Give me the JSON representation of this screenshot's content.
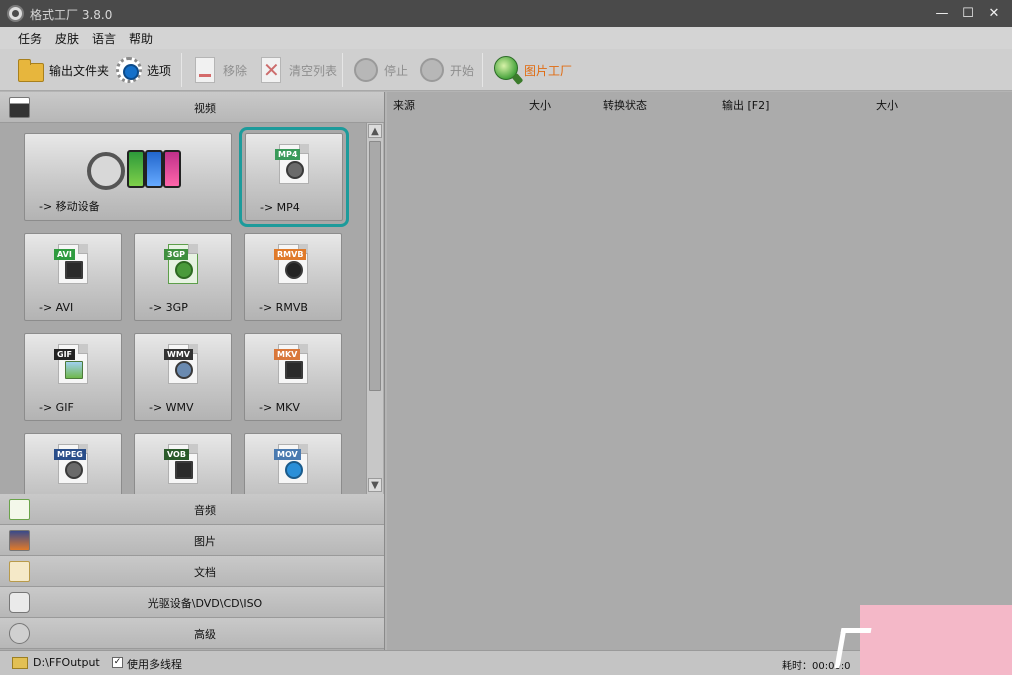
{
  "window": {
    "title": "格式工厂 3.8.0",
    "minimize": "—",
    "maximize": "☐",
    "close": "✕"
  },
  "menu": [
    "任务",
    "皮肤",
    "语言",
    "帮助"
  ],
  "toolbar": {
    "output_folder": "输出文件夹",
    "options": "选项",
    "remove": "移除",
    "clear_list": "清空列表",
    "stop": "停止",
    "start": "开始",
    "picture_factory": "图片工厂"
  },
  "categories": {
    "video": "视频",
    "audio": "音频",
    "picture": "图片",
    "document": "文档",
    "disc": "光驱设备\\DVD\\CD\\ISO",
    "advanced": "高级"
  },
  "video_tiles": [
    {
      "label": "-> 移动设备"
    },
    {
      "label": "-> MP4",
      "tag": "MP4",
      "tag_color": "#3a9a5a"
    },
    {
      "label": "-> AVI",
      "tag": "AVI",
      "tag_color": "#2f9b3f"
    },
    {
      "label": "-> 3GP",
      "tag": "3GP",
      "tag_color": "#3e8f3e"
    },
    {
      "label": "-> RMVB",
      "tag": "RMVB",
      "tag_color": "#e07a2a"
    },
    {
      "label": "-> GIF",
      "tag": "GIF",
      "tag_color": "#222222"
    },
    {
      "label": "-> WMV",
      "tag": "WMV",
      "tag_color": "#333333"
    },
    {
      "label": "-> MKV",
      "tag": "MKV",
      "tag_color": "#d9773a"
    },
    {
      "label": "",
      "tag": "MPEG",
      "tag_color": "#2a4e8a"
    },
    {
      "label": "",
      "tag": "VOB",
      "tag_color": "#2a5a2a"
    },
    {
      "label": "",
      "tag": "MOV",
      "tag_color": "#4a7ab0"
    }
  ],
  "columns": [
    "来源",
    "大小",
    "转换状态",
    "输出 [F2]",
    "大小"
  ],
  "status": {
    "output_path": "D:\\FFOutput",
    "multithread_checked": "✓",
    "multithread": "使用多线程",
    "elapsed": "耗时：00:00:0"
  }
}
